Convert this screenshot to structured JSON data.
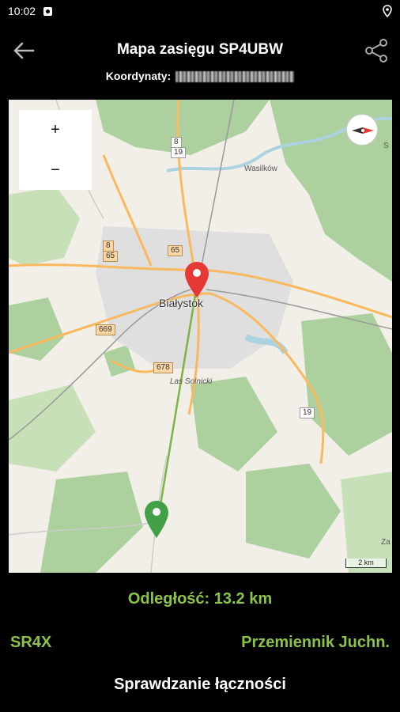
{
  "status_bar": {
    "time": "10:02",
    "icons": [
      "notification-icon",
      "location-icon"
    ]
  },
  "app_bar": {
    "title": "Mapa zasięgu SP4UBW",
    "coords_label": "Koordynaty:",
    "back_icon": "arrow-left-icon",
    "share_icon": "share-icon"
  },
  "map": {
    "zoom_in": "+",
    "zoom_out": "−",
    "city": "Białystok",
    "places": {
      "wasilkow": "Wasilków",
      "las_solnicki": "Las Solnicki",
      "s_edge": "S",
      "za_edge": "Za"
    },
    "roads": {
      "r8": "8",
      "r19_top": "19",
      "r8b": "8",
      "r65a": "65",
      "r65b": "65",
      "r669": "669",
      "r678": "678",
      "r19b": "19"
    },
    "scale_label": "2 km",
    "colors": {
      "line": "#7cb342",
      "red_pin": "#e53935",
      "green_pin": "#43a047"
    }
  },
  "info": {
    "distance": "Odległość: 13.2 km",
    "left_callsign": "SR4X",
    "right_name": "Przemiennik Juchn."
  },
  "actions": {
    "check_connection": "Sprawdzanie łączności"
  }
}
